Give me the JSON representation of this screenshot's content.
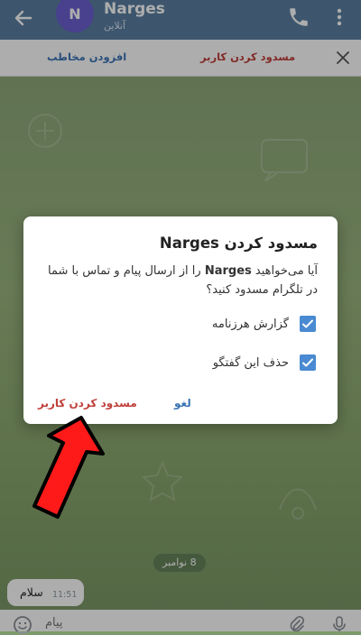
{
  "header": {
    "avatar_letter": "N",
    "contact_name": "Narges",
    "status": "آنلاین"
  },
  "actionbar": {
    "add_contact": "افزودن مخاطب",
    "block_user": "مسدود کردن کاربر"
  },
  "dialog": {
    "title": "مسدود کردن Narges",
    "message_before": "آیا می‌خواهید ",
    "message_name": "Narges",
    "message_after": " را از ارسال پیام و تماس با شما در تلگرام مسدود کنید؟",
    "checkbox_report": "گزارش هرزنامه",
    "checkbox_delete": "حذف این گفتگو",
    "report_checked": true,
    "delete_checked": true,
    "cancel_label": "لغو",
    "confirm_label": "مسدود کردن کاربر"
  },
  "chat": {
    "date_chip": "8 نوامبر",
    "message_text": "سلام",
    "message_time": "11:51"
  },
  "input": {
    "placeholder": "پیام"
  },
  "colors": {
    "header": "#5a7fa3",
    "accent_blue": "#4a8ad2",
    "danger_red": "#c0403a",
    "arrow_red": "#ff1a1a"
  }
}
